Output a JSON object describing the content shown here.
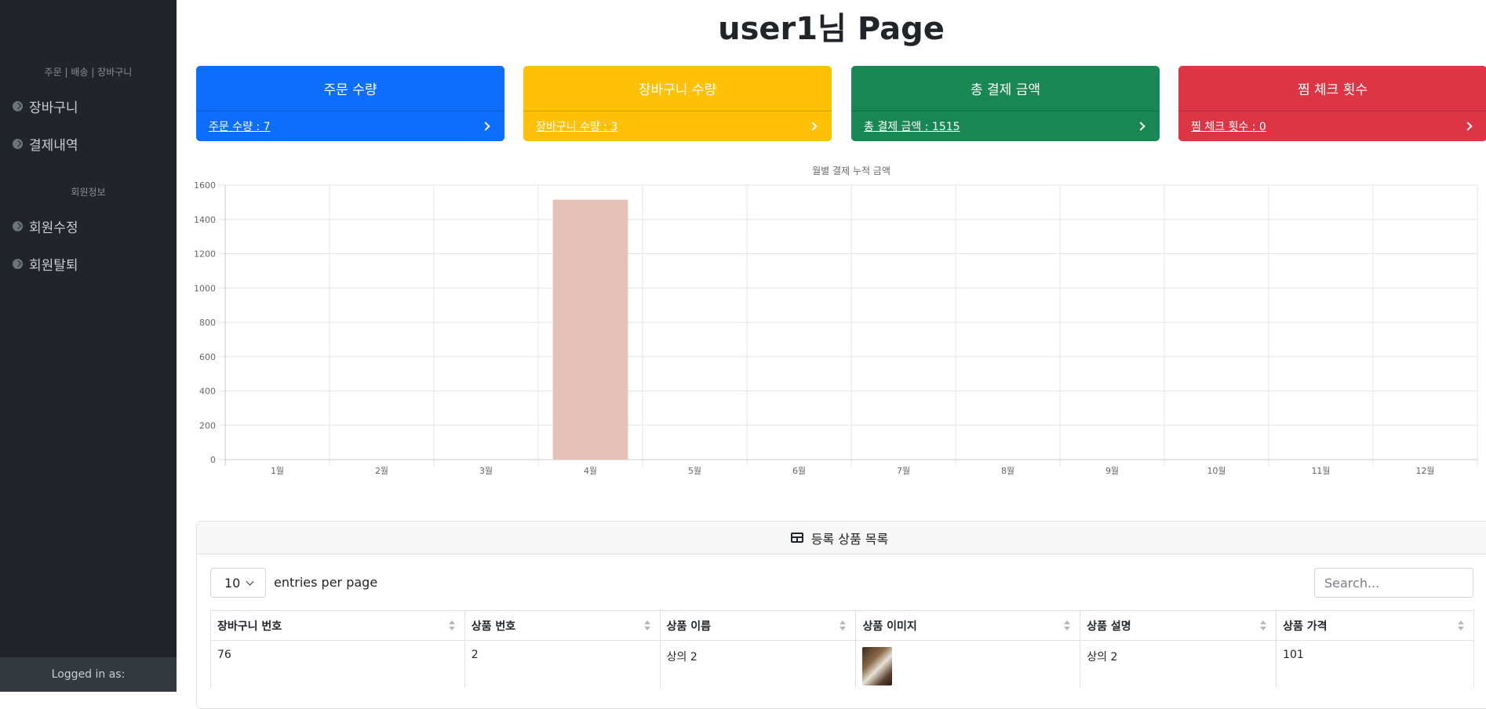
{
  "sidebar": {
    "section1_heading": "주문 | 배송 | 장바구니",
    "section2_heading": "회원정보",
    "items": [
      {
        "label": "장바구니",
        "icon": "circle-arrow-icon"
      },
      {
        "label": "결제내역",
        "icon": "circle-arrow-icon"
      },
      {
        "label": "회원수정",
        "icon": "circle-arrow-icon"
      },
      {
        "label": "회원탈퇴",
        "icon": "circle-arrow-icon"
      }
    ],
    "footer_text": "Logged in as:"
  },
  "header": {
    "title": "user1님 Page"
  },
  "cards": [
    {
      "title": "주문 수량",
      "link": "주문 수량 : 7",
      "color": "#0d6efd"
    },
    {
      "title": "장바구니 수량",
      "link": "장바구니 수량 : 3",
      "color": "#ffc107"
    },
    {
      "title": "총 결제 금액",
      "link": "총 결제 금액 : 1515",
      "color": "#198754"
    },
    {
      "title": "찜 체크 횟수",
      "link": "찜 체크 횟수 : 0",
      "color": "#dc3545"
    }
  ],
  "chart_data": {
    "type": "bar",
    "title": "월별 결제 누적 금액",
    "categories": [
      "1월",
      "2월",
      "3월",
      "4월",
      "5월",
      "6월",
      "7월",
      "8월",
      "9월",
      "10월",
      "11월",
      "12월"
    ],
    "values": [
      0,
      0,
      0,
      1515,
      0,
      0,
      0,
      0,
      0,
      0,
      0,
      0
    ],
    "ylim": [
      0,
      1600
    ],
    "yticks": [
      0,
      200,
      400,
      600,
      800,
      1000,
      1200,
      1400,
      1600
    ],
    "bar_color": "#e6c1b8",
    "grid": true,
    "legend": "none"
  },
  "table_card": {
    "title": "등록 상품 목록",
    "page_size": "10",
    "entries_label": "entries per page",
    "search_placeholder": "Search...",
    "columns": [
      "장바구니 번호",
      "상품 번호",
      "상품 이름",
      "상품 이미지",
      "상품 설명",
      "상품 가격"
    ],
    "rows": [
      {
        "cart_no": "76",
        "product_no": "2",
        "name": "상의 2",
        "image": "product-thumbnail",
        "desc": "상의 2",
        "price": "101"
      }
    ]
  }
}
